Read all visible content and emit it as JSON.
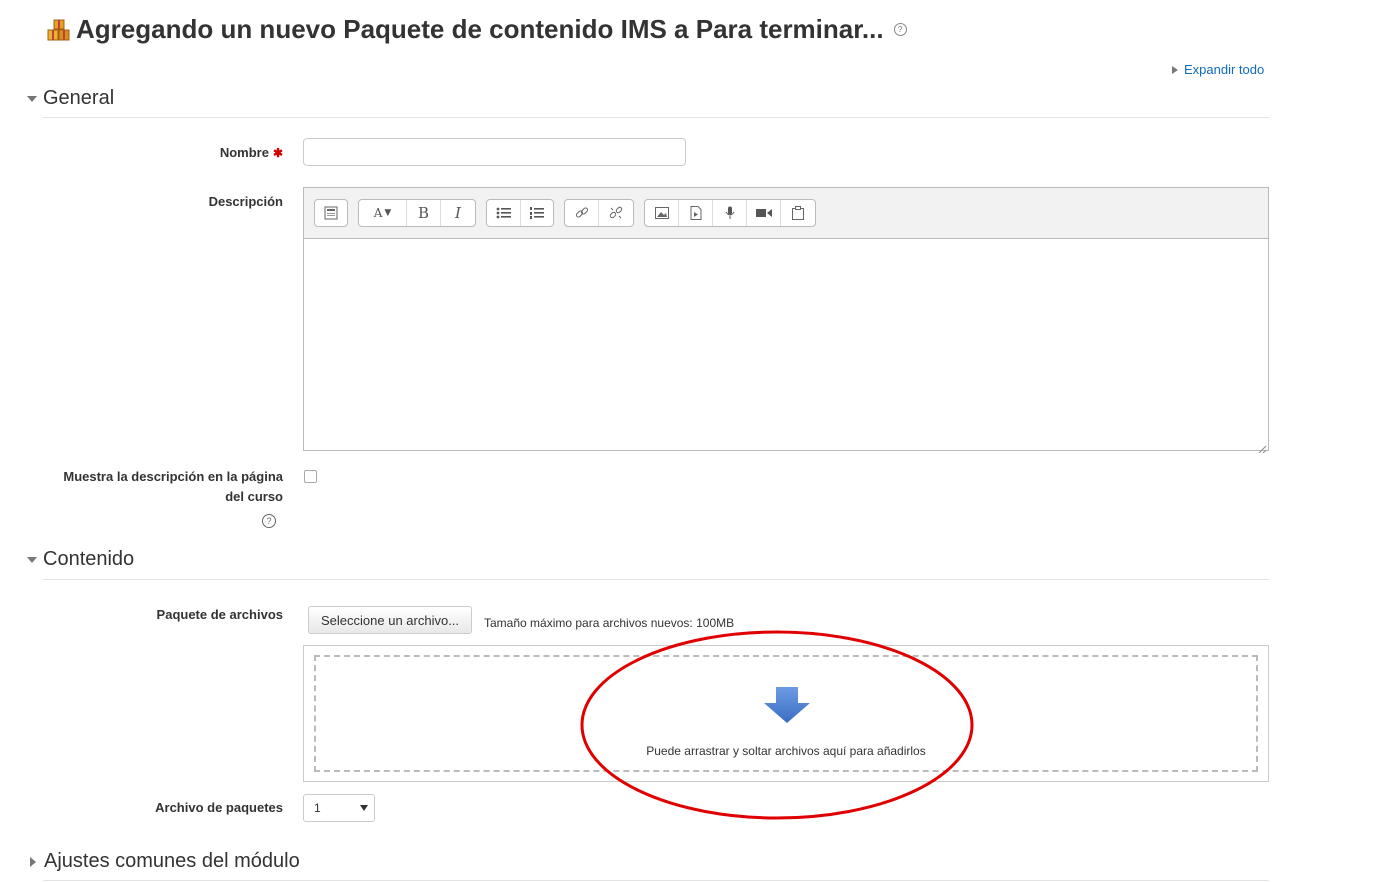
{
  "header": {
    "title": "Agregando un nuevo Paquete de contenido IMS a Para terminar...",
    "title_icon": "package-icon",
    "help_icon": "help-icon"
  },
  "expand_all": "Expandir todo",
  "sections": {
    "general": {
      "title": "General",
      "expanded": true,
      "fields": {
        "name_label": "Nombre",
        "name_required_icon": "required-asterisk-icon",
        "name_value": "",
        "description_label": "Descripción",
        "show_description_label_line1": "Muestra la descripción en la página",
        "show_description_label_line2": "del curso",
        "show_description_checked": false
      },
      "editor_toolbar": [
        [
          "toolbar-toggle-icon"
        ],
        [
          "font-style-icon",
          "bold-icon",
          "italic-icon"
        ],
        [
          "bullet-list-icon",
          "numbered-list-icon"
        ],
        [
          "link-icon",
          "unlink-icon"
        ],
        [
          "image-icon",
          "media-icon",
          "record-audio-icon",
          "record-video-icon",
          "manage-files-icon"
        ]
      ],
      "editor_glyphs": {
        "bold": "B",
        "italic": "I",
        "font": "A"
      }
    },
    "contenido": {
      "title": "Contenido",
      "expanded": true,
      "file_label": "Paquete de archivos",
      "choose_file_button": "Seleccione un archivo...",
      "max_size_text": "Tamaño máximo para archivos nuevos: 100MB",
      "drop_text": "Puede arrastrar y soltar archivos aquí para añadirlos",
      "packages_label": "Archivo de paquetes",
      "packages_selected": "1"
    },
    "common": {
      "title": "Ajustes comunes del módulo",
      "expanded": false
    }
  },
  "colors": {
    "link": "#0f6cbf",
    "annotation": "#e00000",
    "drop_arrow": "#4a7fd4"
  }
}
